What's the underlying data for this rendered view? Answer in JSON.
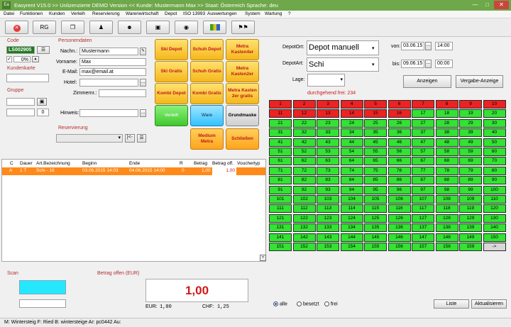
{
  "window": {
    "title": "Easyrent V15.0 >> Unlizenzierte DEMO Version <<   Kunde: Mustermann Max   >> Staat: Österreich Sprache: deu",
    "app_icon": "Ea"
  },
  "menu": [
    "Datei",
    "Funktionen",
    "Kunden",
    "Verleih",
    "Reservierung",
    "Warenwirtschaft",
    "Depot",
    "ISO 13993",
    "Auswertungen",
    "System",
    "Wartung",
    "?"
  ],
  "toolbar": {
    "rg_label": "RG"
  },
  "code": {
    "title": "Code",
    "value": "LS002905",
    "percent": "0%",
    "kundenkarte_label": "Kundenkarte",
    "gruppe_label": "Gruppe",
    "gruppe_value": "0"
  },
  "personendaten": {
    "title": "Personendaten",
    "nachname_label": "Nachn.:",
    "nachname": "Mustermann",
    "vorname_label": "Vorname:",
    "vorname": "Max",
    "email_label": "E-Mail:",
    "email": "max@email.at",
    "hotel_label": "Hotel:",
    "zimmer_label": "Zimmernr.:",
    "hinweis_label": "Hinweis:",
    "reservierung_label": "Reservierung",
    "btn_back": "|<-"
  },
  "tiles": {
    "ski_depot": "Ski Depot",
    "schuh_depot": "Schuh Depot",
    "metra_kasten4er": "Metra Kasten4er",
    "ski_gratis": "Ski Gratis",
    "schuh_gratis": "Schuh Gratis",
    "metra_kasten2er": "Metra Kasten2er",
    "kombi_depot": "Kombi Depot",
    "kombi_gratis": "Kombi Gratis",
    "metra_kasten2er_gratis": "Metra Kasten 2er gratis",
    "verleih": "Verleih",
    "ware": "Ware",
    "grundmaske": "Grundmaske",
    "medium_metra": "Medium Metra",
    "schliessen": "Schließen"
  },
  "depot": {
    "ort_label": "DepotOrt:",
    "ort_value": "Depot manuell",
    "art_label": "DepotArt:",
    "art_value": "Schi",
    "lage_label": "Lage:",
    "von_label": "von:",
    "von_date": "03.06.15",
    "von_time": "14:00",
    "bis_label": "bis:",
    "bis_date": "09.06.15",
    "bis_time": "00:00",
    "anzeigen": "Anzeigen",
    "vergabe_anzeige": "Vergabe-Anzeige",
    "free_text": "durchgehend frei: 234",
    "busy_count": 16,
    "last_number": 159,
    "arrow_label": "->"
  },
  "table": {
    "headers": {
      "c": "C",
      "dauer": "Dauer",
      "art": "Art.Bezeichnung",
      "beginn": "Beginn",
      "ende": "Ende",
      "r": "R",
      "betrag": "Betrag",
      "betrag_off": "Betrag off.",
      "voucher": "Vouchertyp"
    },
    "row": {
      "c": "A",
      "dauer": "1 T",
      "art": "Schi - 16",
      "beginn": "03.06.2015 14:03",
      "ende": "04.06.2015 14:00",
      "r": "0",
      "betrag": "1,00",
      "betrag_off": "1,00",
      "voucher": ""
    }
  },
  "scan": {
    "label": "Scan"
  },
  "betrag": {
    "title": "Betrag offen (EUR)",
    "value": "1,00",
    "eur_label": "EUR:",
    "eur_value": "1,00",
    "chf_label": "CHF:",
    "chf_value": "1,25"
  },
  "filters": {
    "alle": "alle",
    "besetzt": "besetzt",
    "frei": "frei",
    "liste": "Liste",
    "aktualisieren": "Aktualisieren"
  },
  "status": {
    "text": "M: Wintersteig F: Ried B: wintersteige Ar: pc0442 Au:"
  },
  "colors": {
    "free": "#33e233",
    "busy": "#ee2222",
    "accent_title": "#b03030",
    "titlebar": "#6ea84a",
    "amount_red": "#d01818"
  }
}
